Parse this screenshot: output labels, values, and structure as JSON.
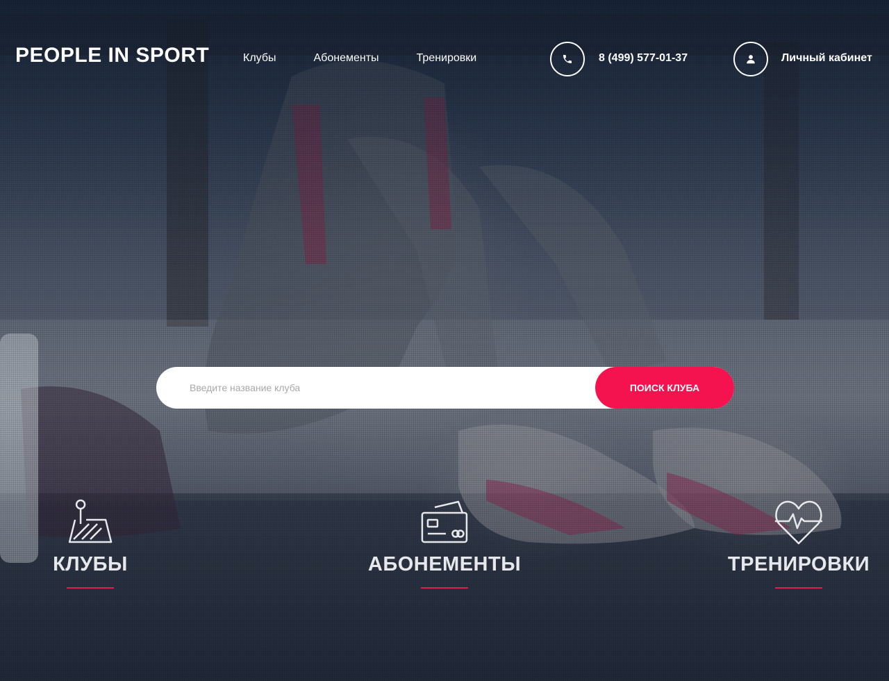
{
  "header": {
    "logo": "PEOPLE IN SPORT",
    "nav": [
      "Клубы",
      "Абонементы",
      "Тренировки"
    ],
    "phone": "8 (499) 577-01-37",
    "account_label": "Личный кабинет"
  },
  "search": {
    "placeholder": "Введите название клуба",
    "button_label": "Поиск клуба"
  },
  "categories": [
    {
      "label": "КЛУБЫ",
      "icon": "map-pin-icon"
    },
    {
      "label": "АБОНЕМЕНТЫ",
      "icon": "membership-card-icon"
    },
    {
      "label": "ТРЕНИРОВКИ",
      "icon": "heart-pulse-icon"
    }
  ],
  "colors": {
    "accent": "#f4134f",
    "underline": "#e0204f",
    "text": "#ffffff"
  }
}
